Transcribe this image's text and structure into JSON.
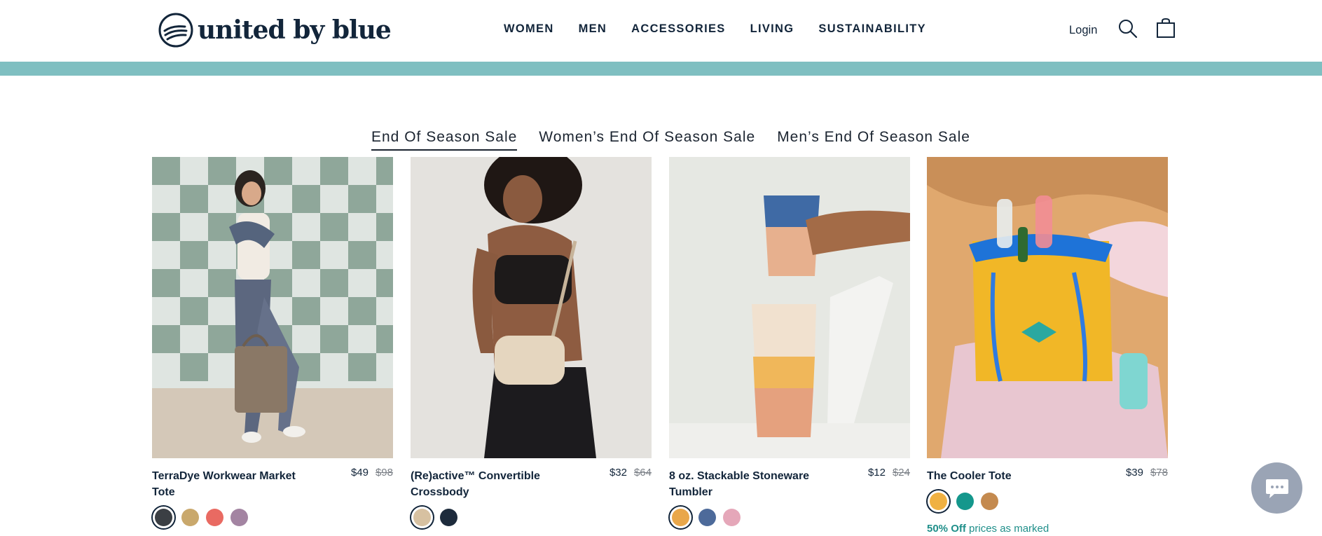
{
  "header": {
    "logo_text": "united by blue",
    "nav": [
      "WOMEN",
      "MEN",
      "ACCESSORIES",
      "LIVING",
      "SUSTAINABILITY"
    ],
    "login": "Login",
    "icons": [
      "search-icon",
      "shopping-bag-icon"
    ]
  },
  "colors": {
    "brand_navy": "#12253a",
    "band_teal": "#7fbfc1",
    "promo_teal": "#1f8f8a"
  },
  "tabs": [
    {
      "label": "End Of Season Sale",
      "active": true
    },
    {
      "label": "Women’s End Of Season Sale",
      "active": false
    },
    {
      "label": "Men’s End Of Season Sale",
      "active": false
    }
  ],
  "products": [
    {
      "name": "TerraDye Workwear Market Tote",
      "price": "$49",
      "old_price": "$98",
      "swatches": [
        "#3b3f44",
        "#c9a86c",
        "#e96a62",
        "#a384a2"
      ]
    },
    {
      "name": "(Re)active™ Convertible Crossbody",
      "price": "$32",
      "old_price": "$64",
      "swatches": [
        "#d7c1a1",
        "#1d2b3c"
      ]
    },
    {
      "name": "8 oz. Stackable Stoneware Tumbler",
      "price": "$12",
      "old_price": "$24",
      "swatches": [
        "#e9a74a",
        "#4d6a9a",
        "#e5a7b9"
      ]
    },
    {
      "name": "The Cooler Tote",
      "price": "$39",
      "old_price": "$78",
      "swatches": [
        "#f0b142",
        "#14978c",
        "#c48a4f"
      ]
    }
  ],
  "promo": {
    "bold": "50% Off",
    "rest": "prices as marked"
  }
}
